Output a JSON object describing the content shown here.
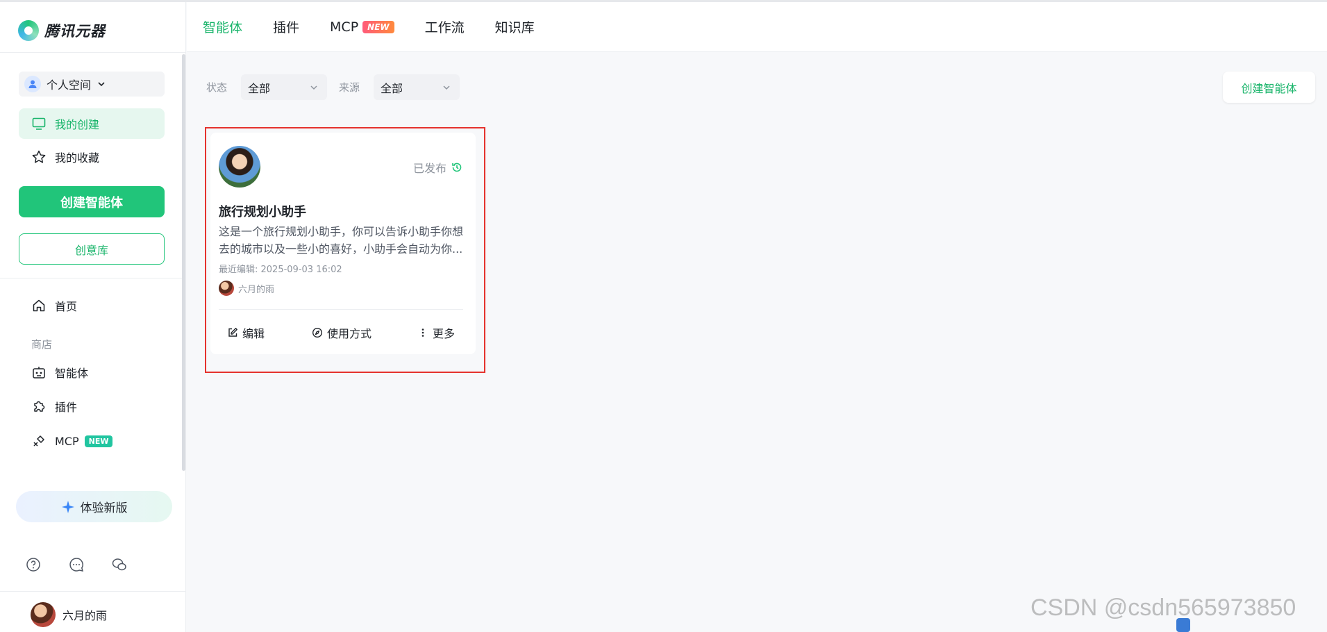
{
  "brand": {
    "name": "腾讯元器",
    "logo_icon": "yuanqi-logo-icon"
  },
  "topnav": {
    "tabs": [
      {
        "label": "智能体",
        "active": true
      },
      {
        "label": "插件"
      },
      {
        "label": "MCP",
        "badge": "NEW"
      },
      {
        "label": "工作流"
      },
      {
        "label": "知识库"
      }
    ]
  },
  "sidebar": {
    "space": {
      "label": "个人空间"
    },
    "my_created": "我的创建",
    "my_favorites": "我的收藏",
    "create_button": "创建智能体",
    "idea_button": "创意库",
    "home": "首页",
    "store_label": "商店",
    "store_items": [
      {
        "label": "智能体",
        "icon": "robot-icon"
      },
      {
        "label": "插件",
        "icon": "puzzle-icon"
      },
      {
        "label": "MCP",
        "icon": "link-icon",
        "badge": "NEW"
      }
    ],
    "new_version_button": "体验新版",
    "bottom_icons": [
      "help-icon",
      "message-icon",
      "wechat-icon"
    ],
    "user_name": "六月的雨"
  },
  "filters": {
    "status_label": "状态",
    "status_value": "全部",
    "source_label": "来源",
    "source_value": "全部",
    "create_button": "创建智能体"
  },
  "card": {
    "status": "已发布",
    "title": "旅行规划小助手",
    "description": "这是一个旅行规划小助手，你可以告诉小助手你想去的城市以及一些小的喜好，小助手会自动为你...",
    "edited": "最近编辑: 2025-09-03 16:02",
    "author": "六月的雨",
    "actions": {
      "edit": "编辑",
      "usage": "使用方式",
      "more": "更多"
    }
  },
  "watermark": "CSDN @csdn565973850",
  "colors": {
    "accent": "#21c57a",
    "highlight": "#e5322d"
  }
}
